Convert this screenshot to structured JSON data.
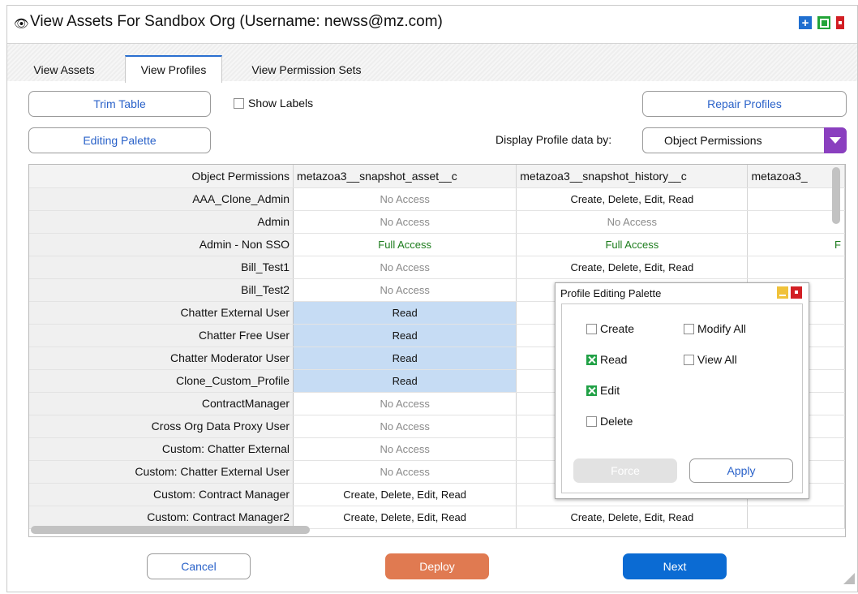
{
  "window": {
    "title": "View Assets For Sandbox Org (Username: newss@mz.com)",
    "eye_icon": "eye-icon",
    "controls": [
      "plus-icon",
      "maximize-icon",
      "close-icon"
    ]
  },
  "tabs": [
    {
      "label": "View Assets",
      "active": false
    },
    {
      "label": "View Profiles",
      "active": true
    },
    {
      "label": "View Permission Sets",
      "active": false
    }
  ],
  "toolbar": {
    "trim_table": "Trim Table",
    "show_labels": "Show Labels",
    "repair_profiles": "Repair Profiles",
    "editing_palette": "Editing Palette",
    "display_by_label": "Display Profile data by:",
    "display_by_value": "Object Permissions"
  },
  "table": {
    "corner_header": "Object Permissions",
    "columns": [
      "metazoa3__snapshot_asset__c",
      "metazoa3__snapshot_history__c",
      "metazoa3_"
    ],
    "rows": [
      {
        "name": "AAA_Clone_Admin",
        "cells": [
          "No Access",
          "Create, Delete, Edit, Read",
          ""
        ]
      },
      {
        "name": "Admin",
        "cells": [
          "No Access",
          "No Access",
          ""
        ]
      },
      {
        "name": "Admin - Non SSO",
        "cells": [
          "Full Access",
          "Full Access",
          "F"
        ]
      },
      {
        "name": "Bill_Test1",
        "cells": [
          "No Access",
          "Create, Delete, Edit, Read",
          ""
        ]
      },
      {
        "name": "Bill_Test2",
        "cells": [
          "No Access",
          "",
          ""
        ]
      },
      {
        "name": "Chatter External User",
        "cells": [
          "Read",
          "",
          ""
        ]
      },
      {
        "name": "Chatter Free User",
        "cells": [
          "Read",
          "",
          ""
        ]
      },
      {
        "name": "Chatter Moderator User",
        "cells": [
          "Read",
          "",
          ""
        ]
      },
      {
        "name": "Clone_Custom_Profile",
        "cells": [
          "Read",
          "",
          ""
        ]
      },
      {
        "name": "ContractManager",
        "cells": [
          "No Access",
          "",
          ""
        ]
      },
      {
        "name": "Cross Org Data Proxy User",
        "cells": [
          "No Access",
          "",
          ""
        ]
      },
      {
        "name": "Custom: Chatter External",
        "cells": [
          "No Access",
          "",
          ""
        ]
      },
      {
        "name": "Custom: Chatter External User",
        "cells": [
          "No Access",
          "",
          ""
        ]
      },
      {
        "name": "Custom: Contract Manager",
        "cells": [
          "Create, Delete, Edit, Read",
          "",
          ""
        ]
      },
      {
        "name": "Custom: Contract Manager2",
        "cells": [
          "Create, Delete, Edit, Read",
          "Create, Delete, Edit, Read",
          ""
        ]
      }
    ]
  },
  "palette": {
    "title": "Profile Editing Palette",
    "options": {
      "create": {
        "label": "Create",
        "checked": false
      },
      "modify_all": {
        "label": "Modify All",
        "checked": false
      },
      "read": {
        "label": "Read",
        "checked": true
      },
      "view_all": {
        "label": "View All",
        "checked": false
      },
      "edit": {
        "label": "Edit",
        "checked": true
      },
      "delete": {
        "label": "Delete",
        "checked": false
      }
    },
    "force": "Force",
    "apply": "Apply"
  },
  "footer": {
    "cancel": "Cancel",
    "deploy": "Deploy",
    "next": "Next"
  },
  "colors": {
    "accent_blue": "#0b6bd3",
    "deploy_orange": "#e07a51",
    "select_purple": "#8a3fbf",
    "full_access_green": "#1c7c1c",
    "selected_cell": "#c6dcf4"
  }
}
